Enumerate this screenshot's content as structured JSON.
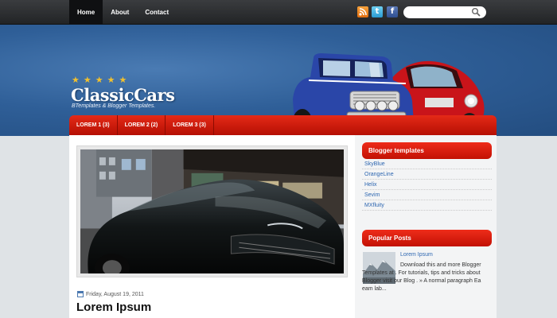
{
  "topnav": {
    "items": [
      {
        "label": "Home",
        "active": true
      },
      {
        "label": "About",
        "active": false
      },
      {
        "label": "Contact",
        "active": false
      }
    ]
  },
  "social": {
    "icons": [
      "rss-icon",
      "twitter-icon",
      "facebook-icon"
    ]
  },
  "search": {
    "placeholder": ""
  },
  "header": {
    "title": "ClassicCars",
    "tagline": "BTemplates & Blogger Templates.",
    "stars": 5
  },
  "menu": {
    "items": [
      {
        "label": "LOREM 1 (3)"
      },
      {
        "label": "LOREM 2 (2)"
      },
      {
        "label": "LOREM 3 (3)"
      }
    ]
  },
  "post": {
    "date": "Friday, August 19, 2011",
    "title": "Lorem Ipsum"
  },
  "sidebar": {
    "blogger_templates": {
      "title": "Blogger templates",
      "links": [
        "SkyBlue",
        "OrangeLine",
        "Helix",
        "Sevim",
        "MXfluity"
      ]
    },
    "popular_posts": {
      "title": "Popular Posts",
      "item_title": "Lorem Ipsum",
      "item_text": "Download this and more Blogger Templates at . For tutorials, tips and tricks about Blogger visit our Blog . » A normal paragraph Ea eam lab..."
    }
  },
  "colors": {
    "accent_red": "#d01c0c",
    "header_blue": "#2f5f98",
    "link_blue": "#2e67b1",
    "star_gold": "#f2c12e"
  }
}
